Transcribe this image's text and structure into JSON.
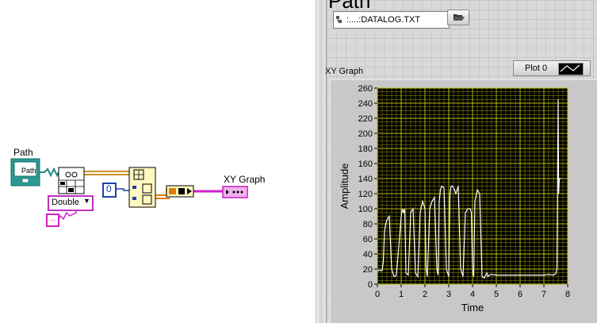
{
  "block_diagram": {
    "path_label": "Path",
    "path_terminal_text": "Path",
    "type_dropdown": "Double",
    "constant_zero": "0",
    "ellipsis_const": "...",
    "xy_graph_label": "XY Graph"
  },
  "front_panel": {
    "path_title": "Path",
    "path_value": ":....:DATALOG.TXT",
    "legend_plot_name": "Plot 0",
    "graph_label": "XY Graph"
  },
  "chart_data": {
    "type": "line",
    "xlabel": "Time",
    "ylabel": "Amplitude",
    "xlim": [
      0,
      8
    ],
    "ylim": [
      0,
      260
    ],
    "xticks": [
      "0",
      "1",
      "2",
      "3",
      "4",
      "5",
      "6",
      "7",
      "8"
    ],
    "yticks": [
      "0",
      "20",
      "40",
      "60",
      "80",
      "100",
      "120",
      "140",
      "160",
      "180",
      "200",
      "220",
      "240",
      "260"
    ],
    "grid": true,
    "background": "#000000",
    "grid_color": "#9a9a00",
    "line_color": "#ffffff",
    "x": [
      0,
      0.18,
      0.2,
      0.25,
      0.3,
      0.35,
      0.4,
      0.5,
      0.6,
      0.7,
      0.8,
      0.9,
      1.0,
      1.05,
      1.1,
      1.15,
      1.2,
      1.3,
      1.4,
      1.5,
      1.6,
      1.7,
      1.8,
      1.9,
      1.95,
      2.0,
      2.05,
      2.1,
      2.2,
      2.3,
      2.4,
      2.5,
      2.55,
      2.6,
      2.65,
      2.7,
      2.8,
      2.9,
      3.0,
      3.05,
      3.1,
      3.15,
      3.2,
      3.3,
      3.4,
      3.5,
      3.6,
      3.7,
      3.8,
      3.9,
      3.95,
      4.0,
      4.05,
      4.1,
      4.2,
      4.3,
      4.4,
      4.5,
      4.55,
      4.6,
      4.65,
      4.7,
      4.8,
      5.0,
      5.5,
      6.0,
      6.5,
      7.0,
      7.2,
      7.4,
      7.5,
      7.55,
      7.6,
      7.62,
      7.65,
      7.7,
      7.72
    ],
    "y": [
      18,
      18,
      18,
      30,
      70,
      80,
      85,
      90,
      20,
      10,
      12,
      50,
      90,
      100,
      95,
      100,
      15,
      12,
      95,
      100,
      15,
      10,
      95,
      110,
      105,
      100,
      20,
      10,
      100,
      110,
      115,
      20,
      12,
      110,
      125,
      130,
      128,
      20,
      10,
      120,
      130,
      130,
      128,
      120,
      130,
      20,
      10,
      95,
      100,
      100,
      95,
      20,
      10,
      110,
      125,
      120,
      10,
      8,
      12,
      15,
      10,
      12,
      13,
      12,
      12,
      12,
      12,
      12,
      13,
      12,
      14,
      20,
      245,
      120,
      140,
      140,
      140
    ]
  }
}
